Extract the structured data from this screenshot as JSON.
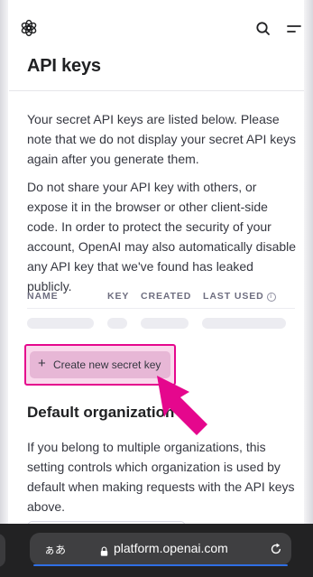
{
  "nav": {
    "logo_icon": "openai-logo-icon",
    "search_icon": "search-icon",
    "menu_icon": "menu-icon"
  },
  "page": {
    "title": "API keys",
    "intro": "Your secret API keys are listed below. Please note that we do not display your secret API keys again after you generate them.",
    "warning": "Do not share your API key with others, or expose it in the browser or other client-side code. In order to protect the security of your account, OpenAI may also automatically disable any API key that we've found has leaked publicly."
  },
  "table": {
    "columns": [
      "NAME",
      "KEY",
      "CREATED",
      "LAST USED"
    ],
    "info_glyph": "i",
    "rows_loading": true
  },
  "create_button": {
    "plus": "+",
    "label": "Create new secret key",
    "highlight_color": "#e5078d"
  },
  "default_org": {
    "title": "Default organization",
    "description": "If you belong to multiple organizations, this setting controls which organization is used by default when making requests with the API keys above."
  },
  "browser": {
    "aa_label": "ぁあ",
    "url": "platform.openai.com",
    "lock_icon": "lock-icon",
    "reload_icon": "reload-icon",
    "accent_color": "#2f6fe4"
  }
}
